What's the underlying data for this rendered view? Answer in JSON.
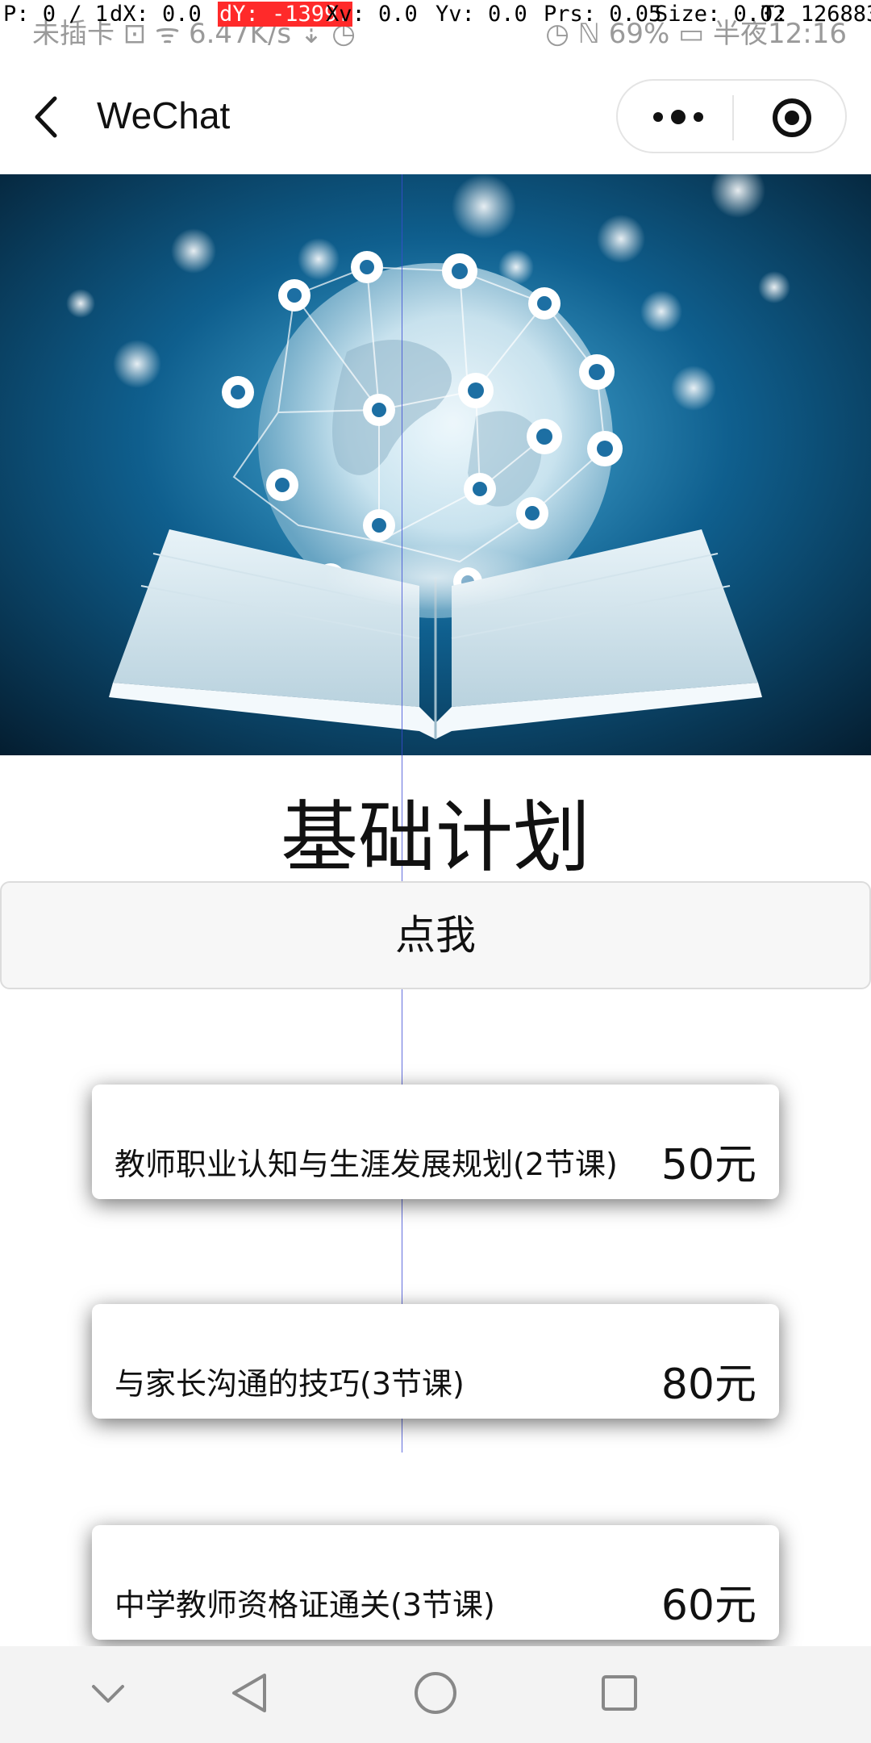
{
  "status_bar": {
    "left_text": "未插卡 ⊡ ᯤ 6.47K/s ⇣ ◷",
    "right_text": "◷ ℕ 69% ▭ 半夜12:16"
  },
  "debug_overlay": {
    "p": "P: 0 / 1",
    "dx": "dX: 0.0",
    "dy": "dY: -1399.",
    "xv": "Xv: 0.0",
    "yv": "Yv: 0.0",
    "prs": "Prs: 0.05",
    "size": "Size: 0.02",
    "t": "T: 126883"
  },
  "nav": {
    "title": "WeChat",
    "back_icon": "chevron-left-icon",
    "more_icon": "more-dots-icon",
    "close_icon": "target-circle-icon"
  },
  "hero": {
    "image": "book-globe-education-network-image"
  },
  "page": {
    "title": "基础计划",
    "button_label": "点我"
  },
  "courses": [
    {
      "name": "教师职业认知与生涯发展规划(2节课)",
      "price": "50元"
    },
    {
      "name": "与家长沟通的技巧(3节课)",
      "price": "80元"
    },
    {
      "name": "中学教师资格证通关(3节课)",
      "price": "60元"
    }
  ],
  "system_nav": {
    "icons": [
      "chevron-down-icon",
      "back-triangle-icon",
      "home-circle-icon",
      "recents-square-icon"
    ]
  },
  "colors": {
    "hero_bg": "#0b4d74",
    "accent_line": "#3c4bd6"
  }
}
